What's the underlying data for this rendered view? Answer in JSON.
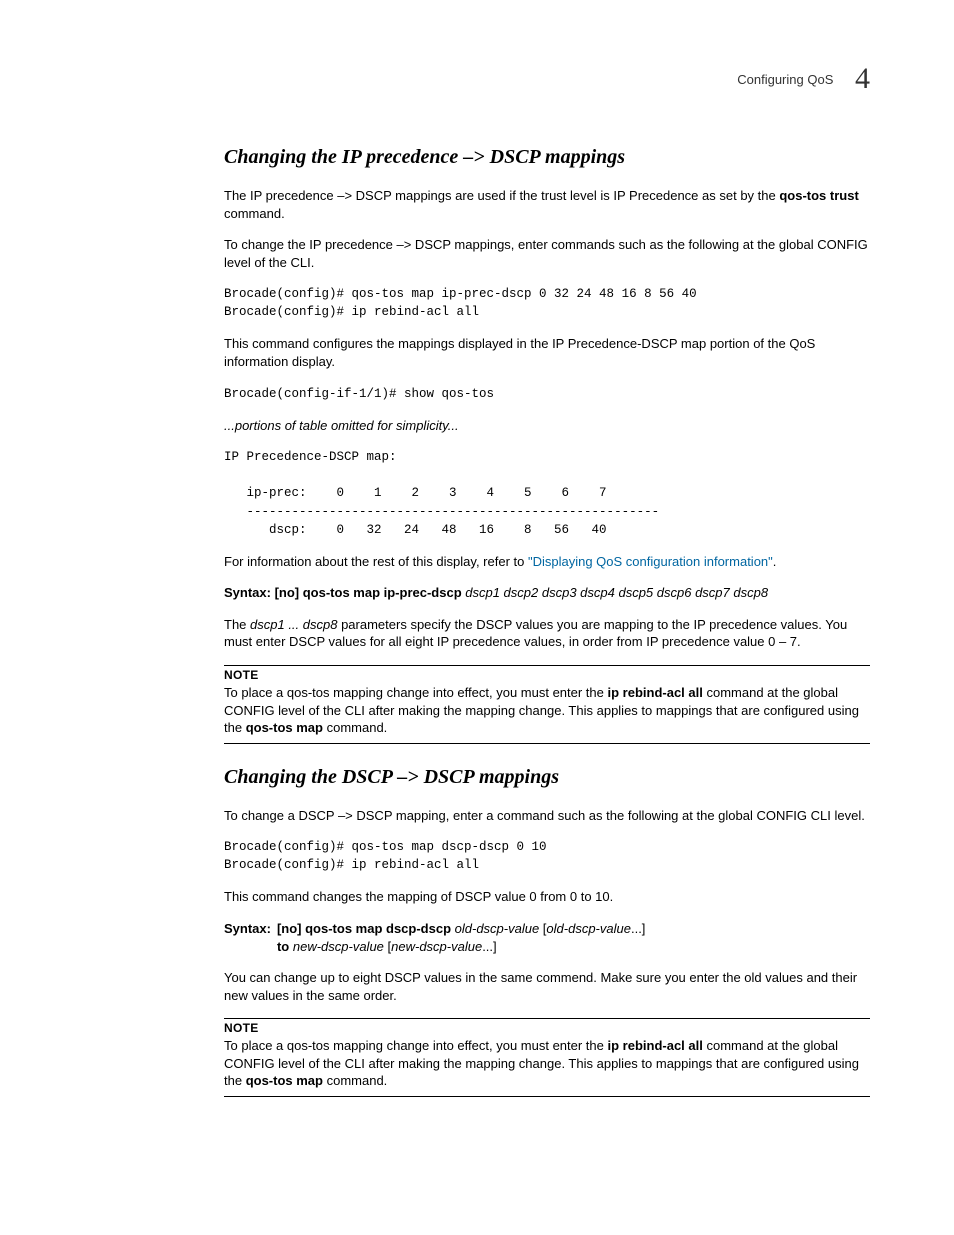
{
  "header": {
    "running_title": "Configuring QoS",
    "chapter_number": "4"
  },
  "sec1": {
    "title": "Changing the IP precedence –> DSCP mappings",
    "p1_a": "The IP precedence –> DSCP mappings are used if the trust level is IP Precedence as set by the ",
    "p1_b": "qos-tos trust",
    "p1_c": " command.",
    "p2": "To change the IP precedence –> DSCP mappings, enter commands such as the following at the global CONFIG level of the CLI.",
    "cli1": "Brocade(config)# qos-tos map ip-prec-dscp 0 32 24 48 16 8 56 40\nBrocade(config)# ip rebind-acl all",
    "p3": "This command configures the mappings displayed in the IP Precedence-DSCP map portion of the QoS information display.",
    "cli2": "Brocade(config-if-1/1)# show qos-tos",
    "omitted": "...portions of table omitted for simplicity...",
    "cli3": "IP Precedence-DSCP map:\n\n   ip-prec:    0    1    2    3    4    5    6    7\n   -------------------------------------------------------\n      dscp:    0   32   24   48   16    8   56   40",
    "p4_a": "For information about the rest of this display, refer to ",
    "p4_link": "\"Displaying QoS configuration information\"",
    "p4_b": ".",
    "syntax": {
      "lead": "Syntax:  ",
      "cmd": "[no] qos-tos map ip-prec-dscp",
      "args": " dscp1 dscp2 dscp3 dscp4 dscp5 dscp6 dscp7 dscp8"
    },
    "p5_a": "The ",
    "p5_b": "dscp1 ... dscp8",
    "p5_c": " parameters specify the DSCP values you are mapping to the IP precedence values. You must enter DSCP values for all eight IP precedence values, in order from IP precedence value 0 – 7.",
    "note": {
      "label": "NOTE",
      "body_a": "To place a qos-tos mapping change into effect, you must enter the ",
      "body_b": "ip rebind-acl all",
      "body_c": " command at the global CONFIG level of the CLI after making the mapping change. This applies to mappings that are configured using the ",
      "body_d": "qos-tos map",
      "body_e": " command."
    }
  },
  "sec2": {
    "title": "Changing the DSCP –> DSCP mappings",
    "p1": "To change a DSCP –> DSCP mapping, enter a command such as the following at the global CONFIG CLI level.",
    "cli1": "Brocade(config)# qos-tos map dscp-dscp 0 10\nBrocade(config)# ip rebind-acl all",
    "p2": "This command changes the mapping of DSCP value 0 from 0 to 10.",
    "syntax": {
      "lead": "Syntax:  ",
      "l1_cmd": "[no] qos-tos map dscp-dscp",
      "l1_a1": " old-dscp-value",
      "l1_t1": " [",
      "l1_a2": "old-dscp-value",
      "l1_t2": "...]",
      "l2_cmd": "to",
      "l2_a1": " new-dscp-value",
      "l2_t1": " [",
      "l2_a2": "new-dscp-value",
      "l2_t2": "...]"
    },
    "p3": "You can change up to eight DSCP values in the same commend. Make sure you enter the old values and their new values in the same order.",
    "note": {
      "label": "NOTE",
      "body_a": "To place a qos-tos mapping change into effect, you must enter the ",
      "body_b": "ip rebind-acl all",
      "body_c": " command at the global CONFIG level of the CLI after making the mapping change. This applies to mappings that are configured using the ",
      "body_d": "qos-tos map",
      "body_e": " command."
    }
  }
}
